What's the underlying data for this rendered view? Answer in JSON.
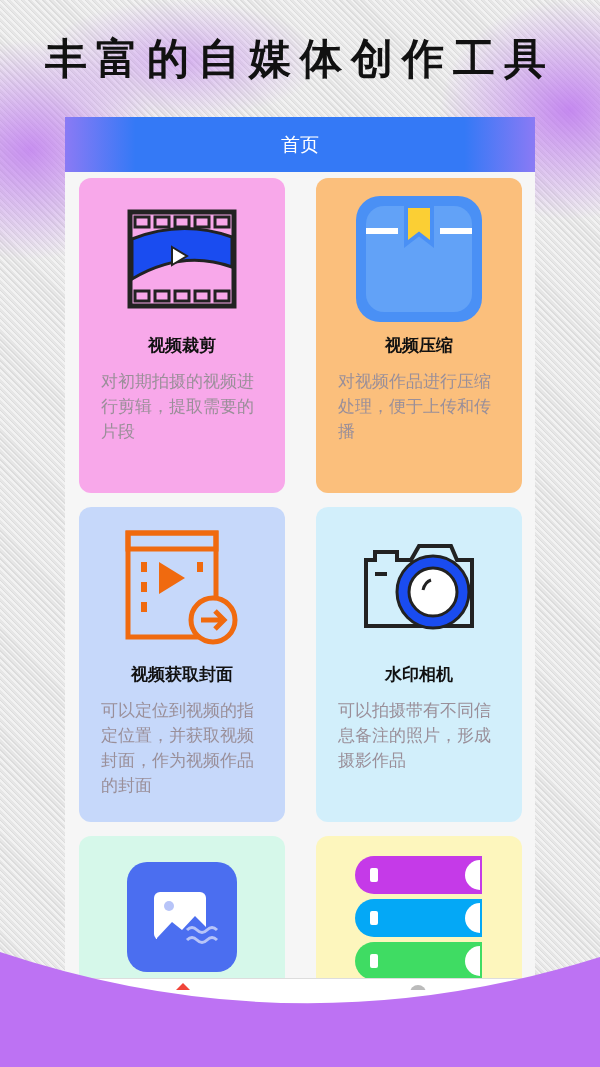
{
  "headline": "丰富的自媒体创作工具",
  "header": {
    "title": "首页"
  },
  "cards": [
    {
      "title": "视频裁剪",
      "description": "对初期拍摄的视频进行剪辑，提取需要的片段",
      "color": "#f8a8ea"
    },
    {
      "title": "视频压缩",
      "description": "对视频作品进行压缩处理，便于上传和传播",
      "color": "#fbbf7c"
    },
    {
      "title": "视频获取封面",
      "description": "可以定位到视频的指定位置，并获取视频封面，作为视频作品的封面",
      "color": "#c6d8fa"
    },
    {
      "title": "水印相机",
      "description": "可以拍摄带有不同信息备注的照片，形成摄影作品",
      "color": "#d2effb"
    },
    {
      "color": "#d6f8ea"
    },
    {
      "color": "#fdf6bd"
    }
  ],
  "tab_bar": [
    {
      "selected": true
    },
    {
      "selected": false
    }
  ]
}
